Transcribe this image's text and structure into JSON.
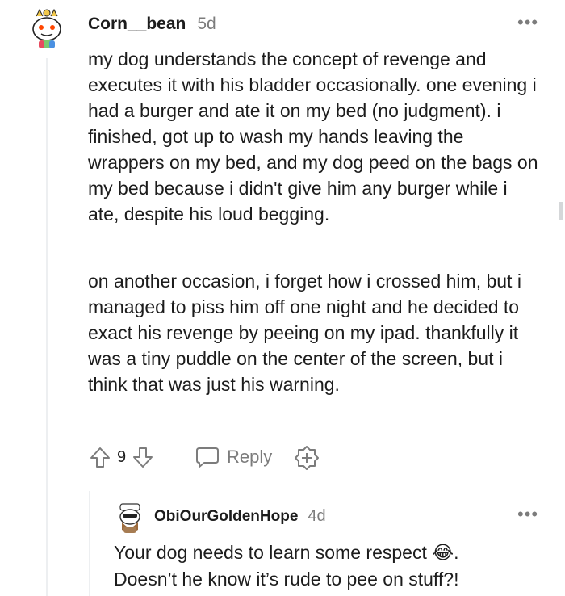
{
  "comment": {
    "username": "Corn__bean",
    "age": "5d",
    "more": "•••",
    "paragraphs": [
      "my dog understands the concept of revenge and executes it with his bladder occasionally. one evening i had a burger and ate it on my bed (no judgment). i finished, got up to wash my hands leaving the wrappers on my bed, and my dog peed on the bags on my bed because i didn't give him any burger while i ate, despite his loud begging.",
      "on another occasion, i forget how i crossed him, but i managed to piss him off one night and he decided to exact his revenge by peeing on my ipad. thankfully it was a tiny puddle on the center of the screen, but i think that was just his warning."
    ],
    "actions": {
      "score": "9",
      "reply_label": "Reply"
    }
  },
  "reply": {
    "username": "ObiOurGoldenHope",
    "age": "4d",
    "more": "•••",
    "line1": "Your dog needs to learn some respect",
    "emoji": "😂",
    "line1_end": ".",
    "line2": "Doesn’t he know it’s rude to pee on stuff?!"
  },
  "icons": {
    "upvote": "upvote-arrow-icon",
    "downvote": "downvote-arrow-icon",
    "reply": "speech-bubble-icon",
    "award": "plus-badge-icon",
    "more": "ellipsis-icon"
  },
  "colors": {
    "text": "#1c1c1c",
    "meta": "#7c7c7c",
    "thread_line": "#edeff1"
  }
}
